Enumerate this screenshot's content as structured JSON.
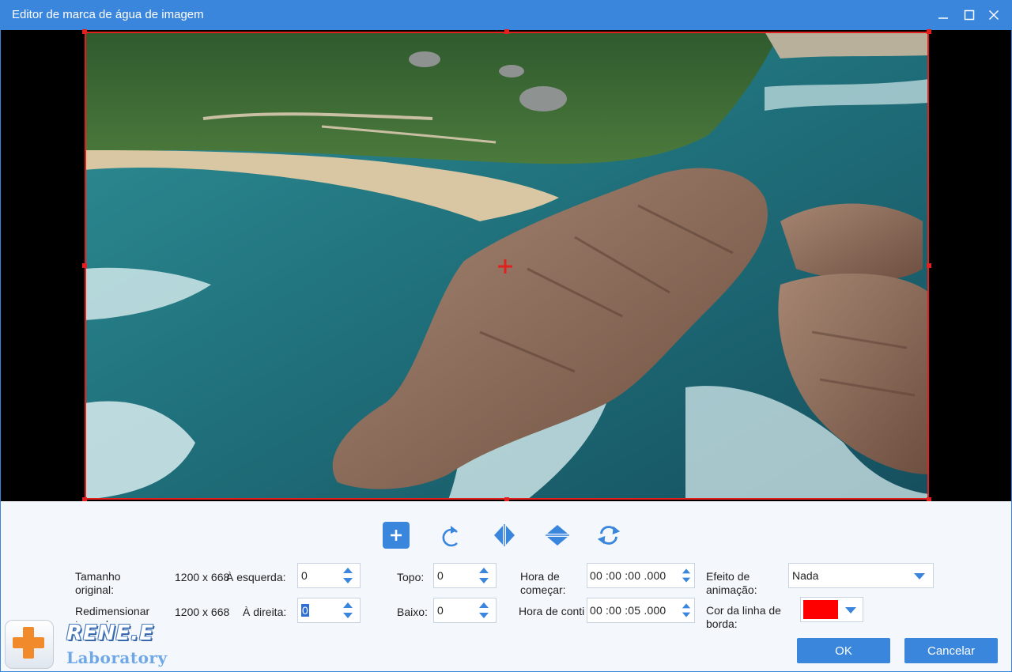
{
  "window": {
    "title": "Editor de marca de água de imagem",
    "controls": [
      "minimize-icon",
      "maximize-icon",
      "close-icon"
    ]
  },
  "toolbar": {
    "icons": [
      "plus-icon",
      "rotate-icon",
      "flip-horizontal-icon",
      "flip-vertical-icon",
      "refresh-icon"
    ]
  },
  "form": {
    "original_size_label": "Tamanho original:",
    "original_size_value": "1200 x 668",
    "resize_label": "Redimensionar tamanho:",
    "resize_value": "1200 x 668",
    "left_label": "À esquerda:",
    "left_value": "0",
    "right_label": "À direita:",
    "right_value": "0",
    "top_label": "Topo:",
    "top_value": "0",
    "bottom_label": "Baixo:",
    "bottom_value": "0",
    "start_time_label": "Hora de começar:",
    "start_time_value": "00 :00 :00 .000",
    "end_time_label": "Hora de conti",
    "end_time_value": "00 :00 :05 .000",
    "animation_label": "Efeito de animação:",
    "animation_value": "Nada",
    "border_color_label": "Cor da linha de borda:",
    "border_color_value": "#ff0000"
  },
  "buttons": {
    "ok": "OK",
    "cancel": "Cancelar"
  },
  "logo": {
    "line1": "RENE.E",
    "line2": "Laboratory"
  },
  "colors": {
    "accent": "#3b86dd",
    "selection": "#e32020"
  }
}
